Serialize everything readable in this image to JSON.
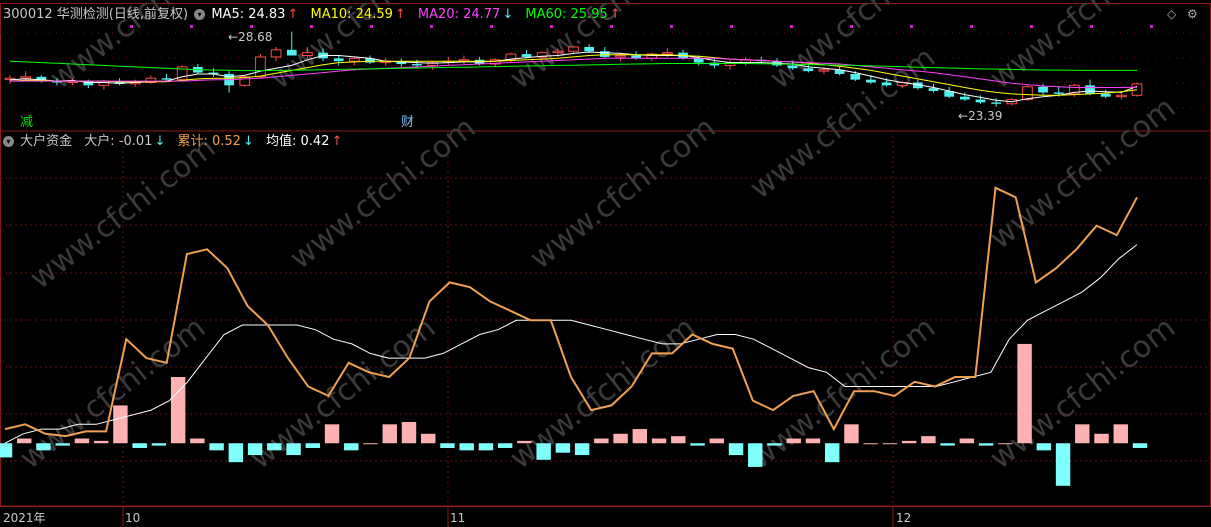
{
  "colors": {
    "bg": "#000000",
    "frame": "#8b1a1a",
    "grid": "#6a1010",
    "up": "#ff4a4a",
    "down": "#4ff0f0",
    "label": "#c8c8c8",
    "ma5": "#ffffff",
    "ma10": "#ffff00",
    "ma20": "#ff40ff",
    "ma60": "#00ff00",
    "cum": "#f0a050",
    "avg": "#ffffff",
    "big_up": "#ffb0b0",
    "big_down": "#80ffff"
  },
  "main_header": {
    "title": "300012 华测检测(日线,前复权)",
    "ma5": "MA5: 24.83",
    "ma5_arrow": "↑",
    "ma10": "MA10: 24.59",
    "ma10_arrow": "↑",
    "ma20": "MA20: 24.77",
    "ma20_arrow": "↓",
    "ma60": "MA60: 25.95",
    "ma60_arrow": "↑"
  },
  "sub_header": {
    "title": "大户资金",
    "big": "大户: -0.01",
    "big_arrow": "↓",
    "cum": "累计: 0.52",
    "cum_arrow": "↓",
    "avg": "均值: 0.42",
    "avg_arrow": "↑"
  },
  "markers": {
    "jian": "减",
    "cai": "财"
  },
  "annotations": {
    "high": "28.68",
    "low": "23.39"
  },
  "x_labels": {
    "year": "2021年",
    "oct": "10",
    "nov": "11",
    "dec": "12"
  },
  "icons": [
    "diamond-icon",
    "restore-icon",
    "close-icon",
    "settings-icon"
  ],
  "chart_data": [
    {
      "type": "candlestick",
      "title": "300012 华测检测(日线,前复权)",
      "dates_note": "Sep 2021 – Dec 2021 daily",
      "ylim": [
        22.6,
        29.5
      ],
      "candles": [
        [
          25.3,
          25.6,
          25.0,
          25.4
        ],
        [
          25.4,
          25.9,
          25.2,
          25.5
        ],
        [
          25.5,
          25.6,
          25.1,
          25.2
        ],
        [
          25.2,
          25.4,
          24.9,
          25.1
        ],
        [
          25.1,
          25.4,
          24.9,
          25.2
        ],
        [
          25.2,
          25.3,
          24.7,
          24.9
        ],
        [
          24.9,
          25.3,
          24.6,
          25.2
        ],
        [
          25.2,
          25.4,
          24.9,
          25.0
        ],
        [
          25.0,
          25.3,
          24.8,
          25.1
        ],
        [
          25.1,
          25.6,
          25.0,
          25.4
        ],
        [
          25.4,
          25.7,
          25.2,
          25.3
        ],
        [
          25.3,
          26.3,
          25.3,
          26.2
        ],
        [
          26.2,
          26.4,
          25.7,
          25.8
        ],
        [
          25.8,
          26.1,
          25.5,
          25.7
        ],
        [
          25.7,
          25.9,
          24.4,
          24.9
        ],
        [
          24.9,
          25.6,
          24.8,
          25.5
        ],
        [
          25.5,
          27.1,
          25.4,
          26.9
        ],
        [
          26.9,
          27.6,
          26.6,
          27.4
        ],
        [
          27.4,
          28.68,
          27.0,
          27.0
        ],
        [
          27.0,
          27.6,
          26.8,
          27.2
        ],
        [
          27.2,
          27.5,
          26.6,
          26.8
        ],
        [
          26.8,
          27.0,
          26.3,
          26.6
        ],
        [
          26.6,
          26.9,
          26.3,
          26.8
        ],
        [
          26.8,
          27.0,
          26.4,
          26.5
        ],
        [
          26.5,
          26.8,
          26.3,
          26.6
        ],
        [
          26.6,
          26.8,
          26.2,
          26.4
        ],
        [
          26.4,
          26.7,
          26.1,
          26.3
        ],
        [
          26.3,
          26.6,
          26.0,
          26.5
        ],
        [
          26.5,
          26.9,
          26.3,
          26.6
        ],
        [
          26.6,
          27.0,
          26.4,
          26.7
        ],
        [
          26.7,
          26.9,
          26.3,
          26.4
        ],
        [
          26.4,
          26.8,
          26.2,
          26.7
        ],
        [
          26.7,
          27.2,
          26.5,
          27.1
        ],
        [
          27.1,
          27.4,
          26.8,
          26.9
        ],
        [
          26.9,
          27.3,
          26.7,
          27.2
        ],
        [
          27.2,
          27.5,
          26.9,
          27.3
        ],
        [
          27.3,
          27.7,
          27.1,
          27.6
        ],
        [
          27.6,
          27.8,
          27.2,
          27.3
        ],
        [
          27.3,
          27.6,
          26.8,
          26.9
        ],
        [
          26.9,
          27.2,
          26.6,
          27.0
        ],
        [
          27.0,
          27.3,
          26.7,
          26.8
        ],
        [
          26.8,
          27.2,
          26.6,
          27.1
        ],
        [
          27.1,
          27.5,
          26.9,
          27.2
        ],
        [
          27.2,
          27.4,
          26.7,
          26.8
        ],
        [
          26.8,
          27.0,
          26.3,
          26.5
        ],
        [
          26.5,
          26.8,
          26.1,
          26.3
        ],
        [
          26.3,
          26.7,
          26.0,
          26.5
        ],
        [
          26.5,
          26.9,
          26.3,
          26.7
        ],
        [
          26.7,
          26.9,
          26.4,
          26.6
        ],
        [
          26.6,
          26.8,
          26.2,
          26.3
        ],
        [
          26.3,
          26.6,
          26.0,
          26.1
        ],
        [
          26.1,
          26.4,
          25.8,
          25.9
        ],
        [
          25.9,
          26.2,
          25.7,
          26.0
        ],
        [
          26.0,
          26.2,
          25.6,
          25.7
        ],
        [
          25.7,
          25.9,
          25.2,
          25.3
        ],
        [
          25.3,
          25.6,
          25.0,
          25.1
        ],
        [
          25.1,
          25.4,
          24.8,
          24.9
        ],
        [
          24.9,
          25.2,
          24.7,
          25.1
        ],
        [
          25.1,
          25.3,
          24.6,
          24.7
        ],
        [
          24.7,
          25.0,
          24.4,
          24.5
        ],
        [
          24.5,
          24.8,
          24.0,
          24.1
        ],
        [
          24.1,
          24.4,
          23.8,
          23.9
        ],
        [
          23.9,
          24.2,
          23.6,
          23.7
        ],
        [
          23.7,
          24.0,
          23.39,
          23.6
        ],
        [
          23.6,
          24.0,
          23.5,
          23.9
        ],
        [
          23.9,
          24.9,
          23.8,
          24.8
        ],
        [
          24.8,
          25.0,
          24.2,
          24.4
        ],
        [
          24.4,
          24.8,
          24.1,
          24.3
        ],
        [
          24.3,
          25.0,
          24.1,
          24.9
        ],
        [
          24.9,
          25.3,
          24.2,
          24.3
        ],
        [
          24.3,
          24.6,
          24.0,
          24.1
        ],
        [
          24.1,
          24.5,
          23.9,
          24.2
        ],
        [
          24.2,
          25.1,
          24.1,
          25.0
        ]
      ],
      "ma": {
        "MA5": [
          25.3,
          25.35,
          25.3,
          25.2,
          25.25,
          25.1,
          25.1,
          25.05,
          25.1,
          25.15,
          25.2,
          25.5,
          25.7,
          25.7,
          25.5,
          25.6,
          25.9,
          26.1,
          26.3,
          26.7,
          27.0,
          27.0,
          26.9,
          26.8,
          26.6,
          26.55,
          26.5,
          26.45,
          26.5,
          26.55,
          26.55,
          26.6,
          26.75,
          26.85,
          26.95,
          27.0,
          27.15,
          27.25,
          27.2,
          27.15,
          27.05,
          27.0,
          27.0,
          27.0,
          26.85,
          26.65,
          26.5,
          26.5,
          26.5,
          26.45,
          26.4,
          26.2,
          26.1,
          26.0,
          25.8,
          25.55,
          25.3,
          25.1,
          24.95,
          24.75,
          24.5,
          24.25,
          24.05,
          23.85,
          23.75,
          23.95,
          24.1,
          24.2,
          24.4,
          24.5,
          24.45,
          24.4,
          24.83
        ],
        "MA10": [
          25.2,
          25.25,
          25.25,
          25.2,
          25.2,
          25.2,
          25.2,
          25.15,
          25.15,
          25.15,
          25.15,
          25.25,
          25.35,
          25.4,
          25.4,
          25.45,
          25.55,
          25.75,
          25.95,
          26.15,
          26.35,
          26.5,
          26.55,
          26.6,
          26.6,
          26.6,
          26.6,
          26.6,
          26.6,
          26.6,
          26.6,
          26.6,
          26.65,
          26.7,
          26.75,
          26.8,
          26.9,
          27.0,
          27.05,
          27.05,
          27.05,
          27.05,
          27.05,
          27.0,
          26.95,
          26.85,
          26.75,
          26.7,
          26.65,
          26.6,
          26.55,
          26.45,
          26.35,
          26.25,
          26.1,
          25.95,
          25.75,
          25.55,
          25.35,
          25.15,
          24.95,
          24.75,
          24.55,
          24.4,
          24.3,
          24.25,
          24.2,
          24.2,
          24.25,
          24.3,
          24.35,
          24.45,
          24.59
        ],
        "MA20": [
          25.2,
          25.2,
          25.2,
          25.2,
          25.2,
          25.2,
          25.2,
          25.2,
          25.2,
          25.2,
          25.2,
          25.2,
          25.25,
          25.3,
          25.3,
          25.35,
          25.4,
          25.5,
          25.6,
          25.7,
          25.8,
          25.9,
          26.0,
          26.05,
          26.1,
          26.15,
          26.2,
          26.25,
          26.3,
          26.35,
          26.4,
          26.45,
          26.5,
          26.55,
          26.6,
          26.65,
          26.7,
          26.75,
          26.8,
          26.8,
          26.8,
          26.8,
          26.8,
          26.8,
          26.8,
          26.8,
          26.75,
          26.7,
          26.65,
          26.6,
          26.55,
          26.5,
          26.45,
          26.4,
          26.3,
          26.2,
          26.1,
          26.0,
          25.9,
          25.8,
          25.65,
          25.5,
          25.35,
          25.2,
          25.05,
          24.95,
          24.85,
          24.8,
          24.75,
          24.75,
          24.75,
          24.75,
          24.77
        ],
        "MA60": [
          26.6,
          26.55,
          26.5,
          26.45,
          26.4,
          26.35,
          26.3,
          26.25,
          26.2,
          26.15,
          26.1,
          26.05,
          26.0,
          25.98,
          25.96,
          25.94,
          25.94,
          25.95,
          25.96,
          25.98,
          26.0,
          26.02,
          26.04,
          26.06,
          26.08,
          26.1,
          26.12,
          26.14,
          26.16,
          26.18,
          26.2,
          26.22,
          26.24,
          26.26,
          26.28,
          26.3,
          26.32,
          26.34,
          26.36,
          26.38,
          26.4,
          26.42,
          26.44,
          26.44,
          26.44,
          26.44,
          26.44,
          26.44,
          26.42,
          26.4,
          26.38,
          26.36,
          26.34,
          26.32,
          26.3,
          26.27,
          26.24,
          26.21,
          26.18,
          26.15,
          26.12,
          26.09,
          26.06,
          26.04,
          26.02,
          26.0,
          25.98,
          25.97,
          25.96,
          25.95,
          25.95,
          25.95,
          25.95
        ]
      }
    },
    {
      "type": "bar+line",
      "title": "大户资金",
      "ylim": [
        -0.12,
        0.62
      ],
      "series": [
        {
          "name": "大户",
          "type": "bar",
          "values": [
            -0.03,
            0.01,
            -0.015,
            -0.005,
            0.01,
            0.005,
            0.08,
            -0.01,
            -0.005,
            0.14,
            0.01,
            -0.015,
            -0.04,
            -0.025,
            -0.015,
            -0.025,
            -0.01,
            0.04,
            -0.015,
            0,
            0.04,
            0.045,
            0.02,
            -0.01,
            -0.015,
            -0.015,
            -0.01,
            0.005,
            -0.035,
            -0.02,
            -0.025,
            0.01,
            0.02,
            0.03,
            0.01,
            0.015,
            -0.005,
            0.01,
            -0.025,
            -0.05,
            -0.005,
            0.01,
            0.01,
            -0.04,
            0.04,
            0,
            0,
            0.005,
            0.015,
            -0.005,
            0.01,
            -0.005,
            0,
            0.21,
            -0.015,
            -0.09,
            0.04,
            0.02,
            0.04,
            -0.01
          ]
        },
        {
          "name": "累计",
          "type": "line",
          "values": [
            0.03,
            0.04,
            0.02,
            0.015,
            0.025,
            0.025,
            0.22,
            0.18,
            0.17,
            0.4,
            0.41,
            0.37,
            0.29,
            0.25,
            0.18,
            0.12,
            0.1,
            0.17,
            0.15,
            0.14,
            0.18,
            0.3,
            0.34,
            0.33,
            0.3,
            0.28,
            0.26,
            0.26,
            0.14,
            0.07,
            0.08,
            0.12,
            0.19,
            0.19,
            0.23,
            0.21,
            0.2,
            0.09,
            0.07,
            0.1,
            0.11,
            0.03,
            0.11,
            0.11,
            0.1,
            0.13,
            0.12,
            0.14,
            0.14,
            0.54,
            0.52,
            0.34,
            0.37,
            0.41,
            0.46,
            0.44,
            0.52
          ]
        },
        {
          "name": "均值",
          "type": "line",
          "values": [
            0.0,
            0.02,
            0.03,
            0.03,
            0.04,
            0.04,
            0.05,
            0.06,
            0.07,
            0.09,
            0.13,
            0.18,
            0.23,
            0.25,
            0.25,
            0.25,
            0.25,
            0.24,
            0.22,
            0.21,
            0.19,
            0.18,
            0.18,
            0.18,
            0.19,
            0.21,
            0.23,
            0.24,
            0.26,
            0.26,
            0.26,
            0.26,
            0.25,
            0.24,
            0.23,
            0.22,
            0.21,
            0.21,
            0.22,
            0.23,
            0.23,
            0.22,
            0.2,
            0.18,
            0.16,
            0.15,
            0.12,
            0.12,
            0.12,
            0.12,
            0.12,
            0.12,
            0.13,
            0.14,
            0.15,
            0.22,
            0.26,
            0.28,
            0.3,
            0.32,
            0.35,
            0.39,
            0.42
          ]
        }
      ]
    }
  ]
}
